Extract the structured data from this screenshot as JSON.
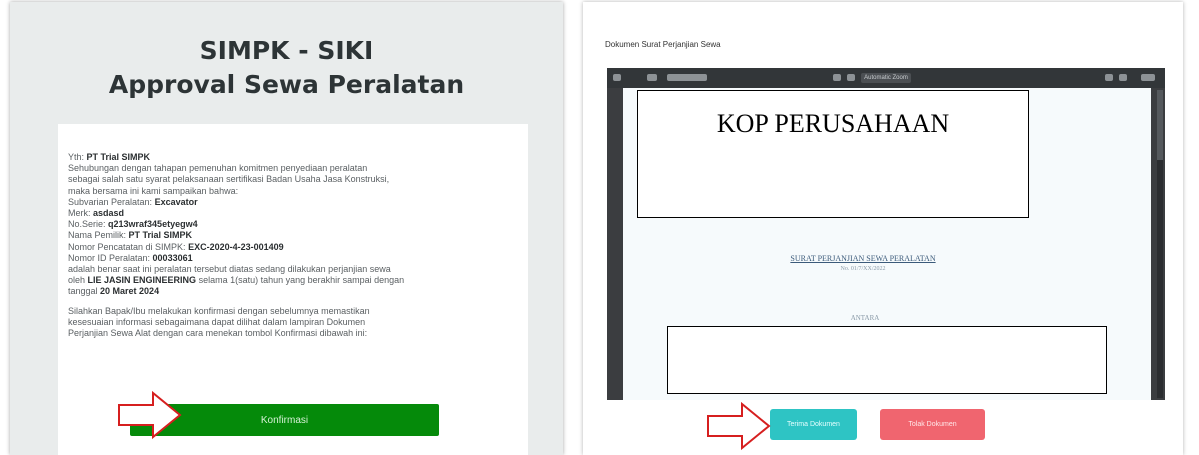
{
  "left": {
    "title_line1": "SIMPK - SIKI",
    "title_line2": "Approval Sewa Peralatan",
    "letter": {
      "yth_prefix": "Yth: ",
      "yth_name": "PT Trial SIMPK",
      "para1_line1": "Sehubungan dengan tahapan pemenuhan komitmen penyediaan peralatan",
      "para1_line2": "sebagai salah satu syarat pelaksanaan sertifikasi Badan Usaha Jasa Konstruksi,",
      "para1_line3": "maka bersama ini kami sampaikan bahwa:",
      "subvarian_label": "Subvarian Peralatan: ",
      "subvarian_value": "Excavator",
      "merk_label": "Merk: ",
      "merk_value": "asdasd",
      "noserie_label": "No.Serie: ",
      "noserie_value": "q213wraf345etyegw4",
      "pemilik_label": "Nama Pemilik: ",
      "pemilik_value": "PT Trial SIMPK",
      "pencatatan_label": "Nomor Pencatatan di SIMPK: ",
      "pencatatan_value": "EXC-2020-4-23-001409",
      "id_label": "Nomor ID Peralatan: ",
      "id_value": "00033061",
      "para2_line1": "adalah benar saat ini peralatan tersebut diatas sedang dilakukan perjanjian sewa",
      "para2_line2_pre": "oleh ",
      "para2_line2_company": "LIE JASIN ENGINEERING",
      "para2_line2_post": " selama 1(satu) tahun yang berakhir sampai dengan",
      "para2_line3_pre": "tanggal ",
      "para2_line3_date": "20 Maret 2024",
      "para3_line1": "Silahkan Bapak/Ibu melakukan konfirmasi dengan sebelumnya memastikan",
      "para3_line2": "kesesuaian informasi sebagaimana dapat dilihat dalam lampiran Dokumen",
      "para3_line3": "Perjanjian Sewa Alat dengan cara menekan tombol Konfirmasi dibawah ini:"
    },
    "confirm_label": "Konfirmasi"
  },
  "right": {
    "heading": "Dokumen Surat Perjanjian Sewa",
    "viewer": {
      "zoom_label": "Automatic Zoom"
    },
    "kop": "KOP PERUSAHAAN",
    "surat_title": "SURAT PERJANJIAN SEWA PERALATAN",
    "surat_no": "No. 01/7/XX/2022",
    "antara": "ANTARA",
    "accept_label": "Terima Dokumen",
    "reject_label": "Tolak Dokumen"
  },
  "colors": {
    "confirm": "#058a0a",
    "accept": "#2ec4c4",
    "reject": "#f0656f",
    "arrow": "#d61f1f"
  },
  "icons": [
    "arrow-right-icon",
    "print-icon",
    "download-icon"
  ]
}
